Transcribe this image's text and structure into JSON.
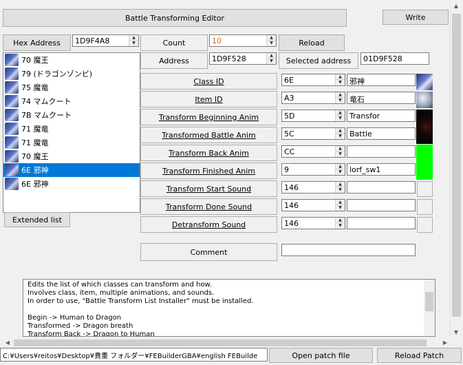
{
  "title_button": "Battle Transforming Editor",
  "write_button": "Write",
  "hex_address_label": "Hex Address",
  "hex_address_value": "1D9F4A8",
  "count_label": "Count",
  "count_value": "10",
  "reload_button": "Reload",
  "address_label": "Address",
  "address_value": "1D9F528",
  "selected_address_label": "Selected address",
  "selected_address_value": "01D9F528",
  "list_items": [
    "70 魔王",
    "79 (ドラゴンゾンビ)",
    "75 魔竜",
    "74 マムクート",
    "7B マムクート",
    "71 魔竜",
    "71 魔竜",
    "70 魔王",
    "6E 邪神",
    "6E 邪神"
  ],
  "selected_index": 8,
  "extended_list_button": "Extended list",
  "fields": {
    "class_id": {
      "label": "Class ID",
      "value": "6E",
      "name": "邪神"
    },
    "item_id": {
      "label": "Item ID",
      "value": "A3",
      "name": "竜石"
    },
    "transform_beginning_anim": {
      "label": "Transform Beginning Anim",
      "value": "5D",
      "name": "Transfor"
    },
    "transformed_battle_anim": {
      "label": "Transformed Battle Anim",
      "value": "5C",
      "name": "Battle"
    },
    "transform_back_anim": {
      "label": "Transform Back Anim",
      "value": "CC",
      "name": ""
    },
    "transform_finished_anim": {
      "label": "Transform Finished Anim",
      "value": "9",
      "name": "lorf_sw1"
    },
    "transform_start_sound": {
      "label": "Transform Start Sound",
      "value": "146",
      "name": ""
    },
    "transform_done_sound": {
      "label": "Transform Done Sound",
      "value": "146",
      "name": ""
    },
    "detransform_sound": {
      "label": "Detransform Sound",
      "value": "146",
      "name": ""
    }
  },
  "comment_label": "Comment",
  "comment_value": "",
  "description": "Edits the list of which classes can transform and how.\nInvolves class, item, multiple animations, and sounds.\nIn order to use, \"Battle Transform List Installer\" must be installed.\n\nBegin -> Human to Dragon\nTransformed -> Dragon breath\nTransform Back -> Dragon to Human",
  "status_path": "C:¥Users¥reitos¥Desktop¥貴重 フォルダー¥FEBuilderGBA¥english FEBuilde",
  "open_patch_button": "Open patch file",
  "reload_patch_button": "Reload Patch",
  "colors": {
    "selection": "#0078d7",
    "green_swatch": "#00ff00",
    "count_text": "#d2691e"
  }
}
